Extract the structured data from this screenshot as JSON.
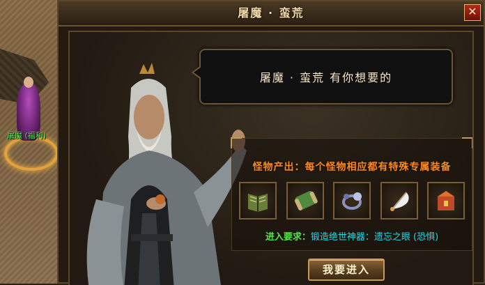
{
  "world": {
    "npc_name": "屠魔 (福利)"
  },
  "window": {
    "title": "屠魔 · 蛮荒",
    "close_label": "✕"
  },
  "dialog": {
    "message": "屠魔 · 蛮荒 有你想要的"
  },
  "panel": {
    "title": "怪物产出：每个怪物相应都有特殊专属装备",
    "items": [
      {
        "icon": "book-icon"
      },
      {
        "icon": "scroll-icon"
      },
      {
        "icon": "ring-icon"
      },
      {
        "icon": "feather-fan-icon"
      },
      {
        "icon": "chest-icon"
      }
    ],
    "requirement_label": "进入要求：",
    "requirement_value": "锻造绝世神器：遗忘之眼 (恐惧)"
  },
  "actions": {
    "enter_label": "我要进入"
  },
  "colors": {
    "title": "#f1d9a8",
    "panel_title": "#ff8a1e",
    "requirement_label": "#56e34b",
    "requirement_value": "#29d8e8",
    "npc_name": "#51e34a"
  }
}
